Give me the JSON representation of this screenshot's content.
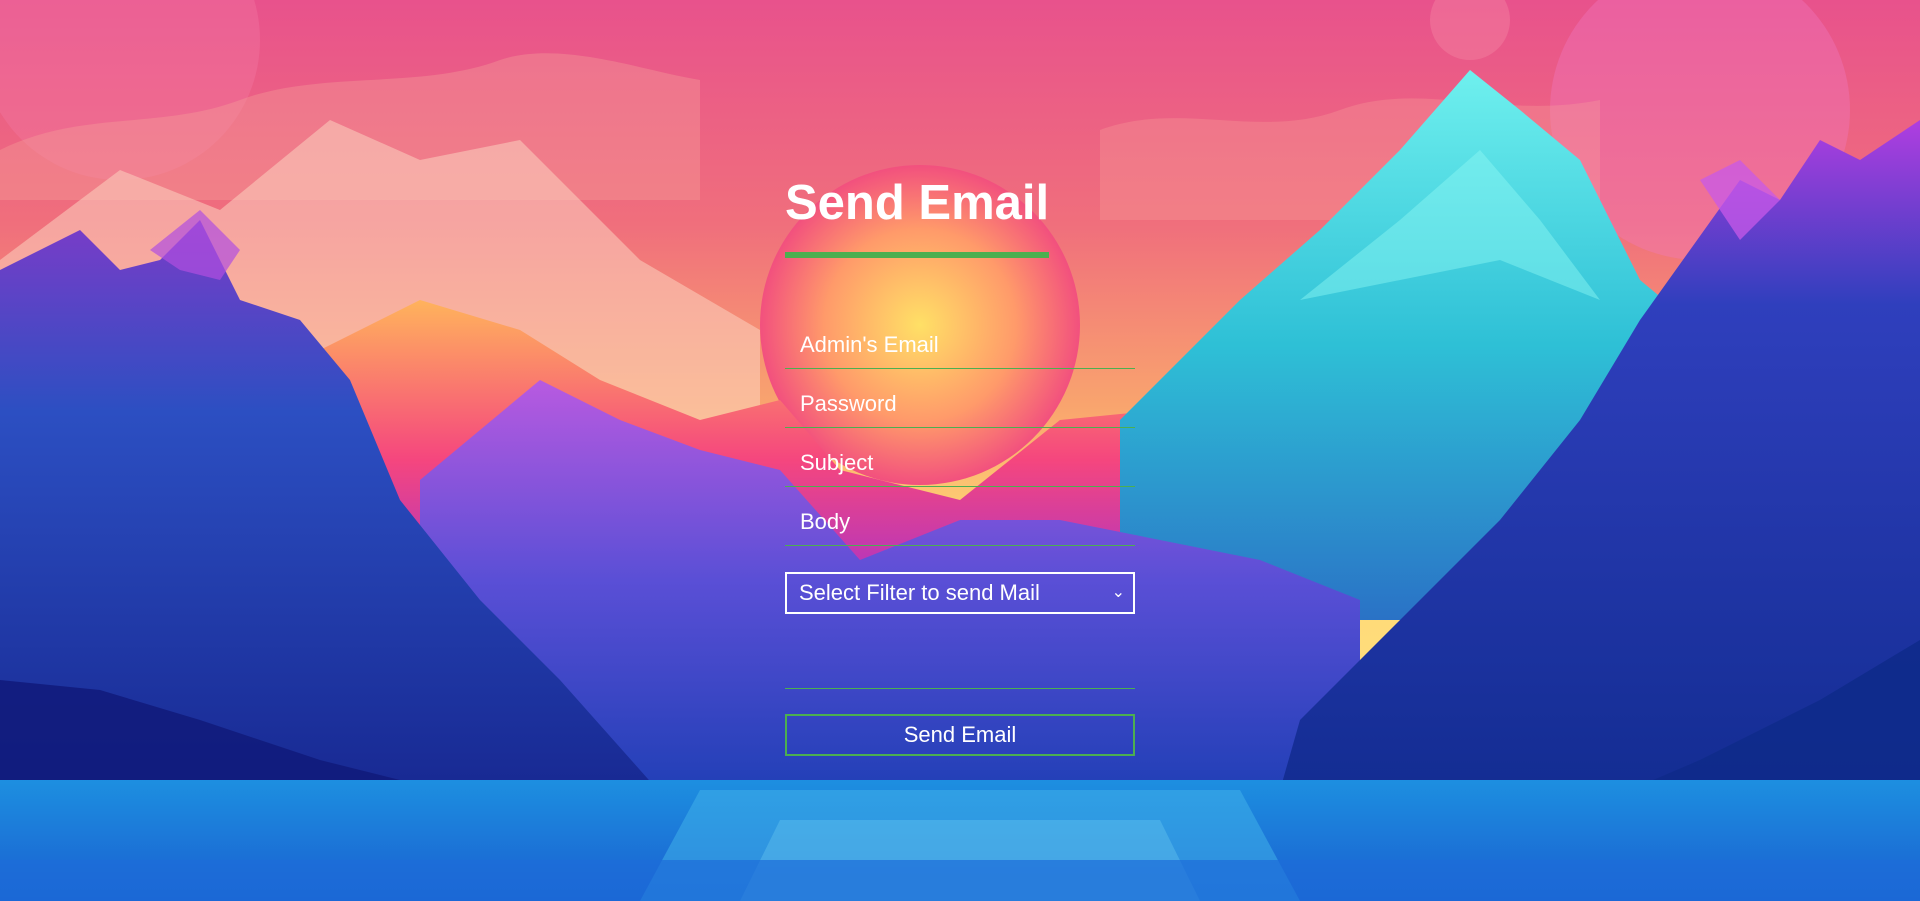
{
  "page": {
    "title": "Send Email"
  },
  "form": {
    "fields": {
      "admin_email": {
        "placeholder": "Admin's Email",
        "value": ""
      },
      "password": {
        "placeholder": "Password",
        "value": ""
      },
      "subject": {
        "placeholder": "Subject",
        "value": ""
      },
      "body": {
        "placeholder": "Body",
        "value": ""
      }
    },
    "filter": {
      "selected": "Select Filter to send Mail"
    },
    "submit_label": "Send Email"
  },
  "colors": {
    "accent": "#4caf50",
    "text": "#ffffff",
    "sky_top": "#e94f8f",
    "sky_mid": "#f7886a",
    "sun": "#ffe066",
    "mountain_deep": "#1a3aa8",
    "water": "#1e7fd8"
  }
}
